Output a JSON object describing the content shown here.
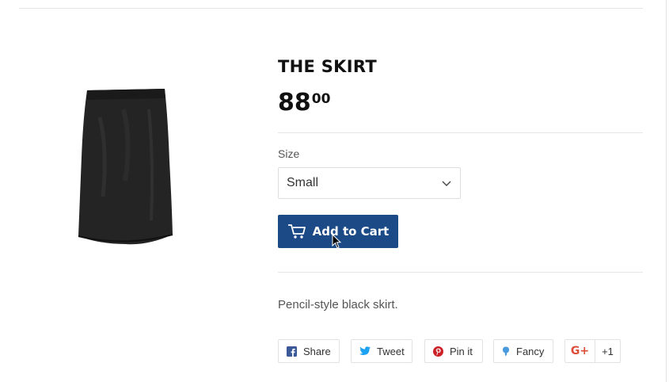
{
  "product": {
    "title": "THE SKIRT",
    "price_main": "88",
    "price_cents": "00",
    "description": "Pencil-style black skirt."
  },
  "options": {
    "size_label": "Size",
    "size_selected": "Small"
  },
  "cart": {
    "add_label": "Add to Cart",
    "button_color": "#1c4a86"
  },
  "social": {
    "share_label": "Share",
    "tweet_label": "Tweet",
    "pin_label": "Pin it",
    "fancy_label": "Fancy",
    "gplus_label": "G+",
    "gplus_count": "+1",
    "icons": [
      "facebook-icon",
      "twitter-icon",
      "pinterest-icon",
      "fancy-icon",
      "google-plus-icon"
    ],
    "colors": {
      "facebook": "#3b5998",
      "twitter": "#1da1f2",
      "pinterest": "#cb2027",
      "fancy": "#4999dc",
      "google_plus": "#dd4b39"
    }
  }
}
